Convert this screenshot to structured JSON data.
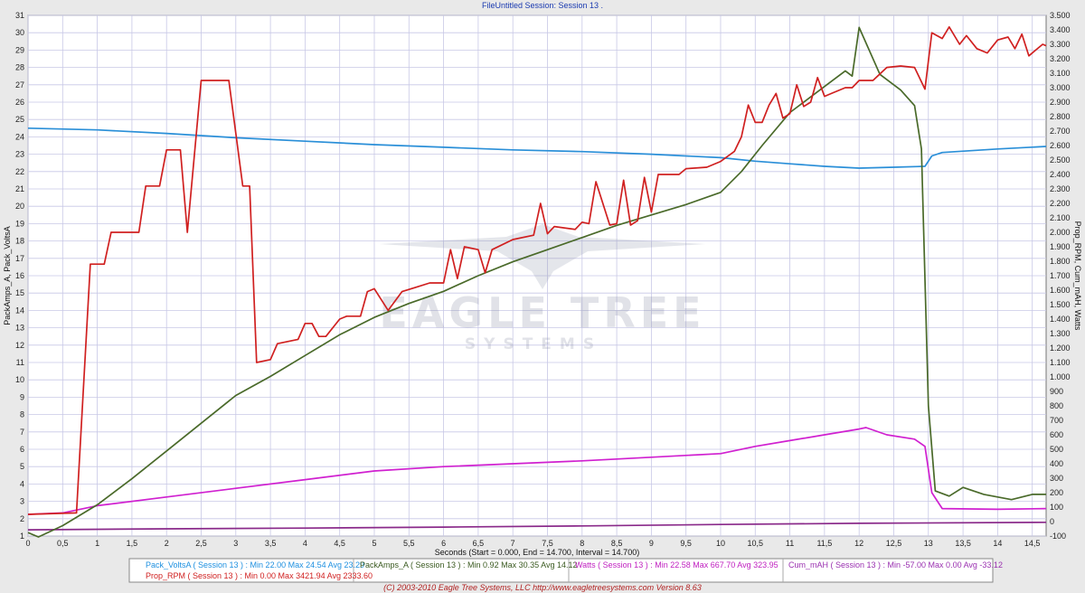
{
  "chart_data": {
    "type": "line",
    "title": "FileUntitled  Session: Session 13 .",
    "xlabel": "Seconds (Start = 0.000,  End = 14.700,  Interval = 14.700)",
    "ylabel_left": "PackAmps_A, Pack_VoltsA",
    "ylabel_right": "Prop_RPM, Cum_mAH, Watts",
    "xlim": [
      0,
      14.7
    ],
    "ylim_left": [
      1,
      31
    ],
    "ylim_right": [
      -100,
      3500
    ],
    "grid": true,
    "x_ticks": [
      "0",
      "0,5",
      "1",
      "1,5",
      "2",
      "2,5",
      "3",
      "3,5",
      "4",
      "4,5",
      "5",
      "5,5",
      "6",
      "6,5",
      "7",
      "7,5",
      "8",
      "8,5",
      "9",
      "9,5",
      "10",
      "10,5",
      "11",
      "11,5",
      "12",
      "12,5",
      "13",
      "13,5",
      "14",
      "14,5"
    ],
    "y_left_ticks": [
      "1",
      "2",
      "3",
      "4",
      "5",
      "6",
      "7",
      "8",
      "9",
      "10",
      "11",
      "12",
      "13",
      "14",
      "15",
      "16",
      "17",
      "18",
      "19",
      "20",
      "21",
      "22",
      "23",
      "24",
      "25",
      "26",
      "27",
      "28",
      "29",
      "30",
      "31"
    ],
    "y_right_ticks": [
      "-100",
      "0",
      "100",
      "200",
      "300",
      "400",
      "500",
      "600",
      "700",
      "800",
      "900",
      "1.000",
      "1.100",
      "1.200",
      "1.300",
      "1.400",
      "1.500",
      "1.600",
      "1.700",
      "1.800",
      "1.900",
      "2.000",
      "2.100",
      "2.200",
      "2.300",
      "2.400",
      "2.500",
      "2.600",
      "2.700",
      "2.800",
      "2.900",
      "3.000",
      "3.100",
      "3.200",
      "3.300",
      "3.400",
      "3.500"
    ],
    "series": [
      {
        "name": "Pack_VoltsA",
        "axis": "left",
        "color": "#2a8fd8",
        "points": [
          [
            0,
            24.5
          ],
          [
            1,
            24.4
          ],
          [
            2,
            24.2
          ],
          [
            3,
            23.95
          ],
          [
            4,
            23.75
          ],
          [
            5,
            23.55
          ],
          [
            6,
            23.4
          ],
          [
            7,
            23.25
          ],
          [
            8,
            23.15
          ],
          [
            9,
            23
          ],
          [
            10,
            22.8
          ],
          [
            10.5,
            22.6
          ],
          [
            11,
            22.45
          ],
          [
            11.5,
            22.3
          ],
          [
            12,
            22.2
          ],
          [
            12.5,
            22.25
          ],
          [
            12.95,
            22.3
          ],
          [
            13.05,
            22.9
          ],
          [
            13.2,
            23.1
          ],
          [
            14,
            23.3
          ],
          [
            14.7,
            23.45
          ]
        ]
      },
      {
        "name": "PackAmps_A",
        "axis": "left",
        "color": "#4a6a2a",
        "points": [
          [
            0,
            1.2
          ],
          [
            0.15,
            0.95
          ],
          [
            0.5,
            1.6
          ],
          [
            1,
            2.8
          ],
          [
            1.5,
            4.3
          ],
          [
            2,
            5.9
          ],
          [
            2.5,
            7.5
          ],
          [
            3,
            9.1
          ],
          [
            3.5,
            10.2
          ],
          [
            4,
            11.4
          ],
          [
            4.5,
            12.6
          ],
          [
            5,
            13.6
          ],
          [
            5.5,
            14.4
          ],
          [
            6,
            15.1
          ],
          [
            6.5,
            16
          ],
          [
            7,
            16.8
          ],
          [
            7.5,
            17.5
          ],
          [
            8,
            18.2
          ],
          [
            8.5,
            18.9
          ],
          [
            9,
            19.5
          ],
          [
            9.5,
            20.1
          ],
          [
            10,
            20.8
          ],
          [
            10.3,
            22
          ],
          [
            10.6,
            23.5
          ],
          [
            11,
            25.4
          ],
          [
            11.5,
            26.9
          ],
          [
            11.8,
            27.8
          ],
          [
            11.9,
            27.5
          ],
          [
            12,
            30.3
          ],
          [
            12.3,
            27.6
          ],
          [
            12.6,
            26.7
          ],
          [
            12.8,
            25.8
          ],
          [
            12.9,
            23.3
          ],
          [
            13,
            8.5
          ],
          [
            13.1,
            3.6
          ],
          [
            13.3,
            3.3
          ],
          [
            13.5,
            3.8
          ],
          [
            13.8,
            3.4
          ],
          [
            14.2,
            3.1
          ],
          [
            14.5,
            3.4
          ],
          [
            14.7,
            3.4
          ]
        ]
      },
      {
        "name": "Watts",
        "axis": "right",
        "color": "#d020d0",
        "points": [
          [
            0,
            50
          ],
          [
            0.5,
            60
          ],
          [
            1,
            110
          ],
          [
            2,
            170
          ],
          [
            3,
            230
          ],
          [
            4,
            290
          ],
          [
            5,
            350
          ],
          [
            6,
            380
          ],
          [
            7,
            400
          ],
          [
            8,
            420
          ],
          [
            9,
            445
          ],
          [
            10,
            470
          ],
          [
            10.5,
            520
          ],
          [
            11,
            560
          ],
          [
            11.5,
            600
          ],
          [
            12,
            640
          ],
          [
            12.1,
            650
          ],
          [
            12.4,
            600
          ],
          [
            12.8,
            570
          ],
          [
            12.95,
            520
          ],
          [
            13.05,
            200
          ],
          [
            13.2,
            90
          ],
          [
            14,
            85
          ],
          [
            14.7,
            90
          ]
        ]
      },
      {
        "name": "Prop_RPM",
        "axis": "right",
        "color": "#d02020",
        "points": [
          [
            0,
            50
          ],
          [
            0.7,
            60
          ],
          [
            0.9,
            1780
          ],
          [
            1.1,
            1780
          ],
          [
            1.2,
            2000
          ],
          [
            1.6,
            2000
          ],
          [
            1.7,
            2320
          ],
          [
            1.9,
            2320
          ],
          [
            2,
            2570
          ],
          [
            2.2,
            2570
          ],
          [
            2.3,
            2000
          ],
          [
            2.5,
            3050
          ],
          [
            2.7,
            3050
          ],
          [
            2.9,
            3050
          ],
          [
            3.1,
            2320
          ],
          [
            3.2,
            2320
          ],
          [
            3.3,
            1100
          ],
          [
            3.5,
            1120
          ],
          [
            3.6,
            1230
          ],
          [
            3.9,
            1260
          ],
          [
            4,
            1370
          ],
          [
            4.1,
            1370
          ],
          [
            4.2,
            1280
          ],
          [
            4.3,
            1280
          ],
          [
            4.5,
            1400
          ],
          [
            4.6,
            1420
          ],
          [
            4.8,
            1420
          ],
          [
            4.9,
            1590
          ],
          [
            5,
            1610
          ],
          [
            5.2,
            1460
          ],
          [
            5.4,
            1590
          ],
          [
            5.6,
            1620
          ],
          [
            5.8,
            1650
          ],
          [
            6,
            1650
          ],
          [
            6.1,
            1880
          ],
          [
            6.2,
            1680
          ],
          [
            6.3,
            1900
          ],
          [
            6.5,
            1880
          ],
          [
            6.6,
            1720
          ],
          [
            6.7,
            1880
          ],
          [
            7,
            1950
          ],
          [
            7.3,
            1980
          ],
          [
            7.4,
            2200
          ],
          [
            7.5,
            1990
          ],
          [
            7.6,
            2040
          ],
          [
            7.9,
            2020
          ],
          [
            8,
            2070
          ],
          [
            8.1,
            2060
          ],
          [
            8.2,
            2350
          ],
          [
            8.4,
            2050
          ],
          [
            8.5,
            2060
          ],
          [
            8.6,
            2360
          ],
          [
            8.7,
            2050
          ],
          [
            8.8,
            2080
          ],
          [
            8.9,
            2380
          ],
          [
            9,
            2140
          ],
          [
            9.1,
            2400
          ],
          [
            9.4,
            2400
          ],
          [
            9.5,
            2440
          ],
          [
            9.8,
            2450
          ],
          [
            10,
            2490
          ],
          [
            10.2,
            2560
          ],
          [
            10.3,
            2660
          ],
          [
            10.4,
            2880
          ],
          [
            10.5,
            2760
          ],
          [
            10.6,
            2760
          ],
          [
            10.7,
            2880
          ],
          [
            10.8,
            2960
          ],
          [
            10.9,
            2790
          ],
          [
            11,
            2820
          ],
          [
            11.1,
            3020
          ],
          [
            11.2,
            2870
          ],
          [
            11.3,
            2900
          ],
          [
            11.4,
            3070
          ],
          [
            11.5,
            2940
          ],
          [
            11.6,
            2960
          ],
          [
            11.8,
            3000
          ],
          [
            11.9,
            3000
          ],
          [
            12,
            3050
          ],
          [
            12.2,
            3050
          ],
          [
            12.4,
            3140
          ],
          [
            12.6,
            3150
          ],
          [
            12.8,
            3140
          ],
          [
            12.95,
            2990
          ],
          [
            13.05,
            3380
          ],
          [
            13.2,
            3340
          ],
          [
            13.3,
            3420
          ],
          [
            13.45,
            3300
          ],
          [
            13.55,
            3360
          ],
          [
            13.7,
            3270
          ],
          [
            13.85,
            3240
          ],
          [
            14,
            3330
          ],
          [
            14.15,
            3350
          ],
          [
            14.25,
            3270
          ],
          [
            14.35,
            3370
          ],
          [
            14.45,
            3220
          ],
          [
            14.55,
            3260
          ],
          [
            14.65,
            3300
          ],
          [
            14.7,
            3290
          ]
        ]
      },
      {
        "name": "Cum_mAH",
        "axis": "right",
        "color": "#8a2a8a",
        "points": [
          [
            0,
            -57
          ],
          [
            2,
            -50
          ],
          [
            4,
            -45
          ],
          [
            6,
            -38
          ],
          [
            8,
            -30
          ],
          [
            10,
            -20
          ],
          [
            12,
            -12
          ],
          [
            14.7,
            -5
          ]
        ]
      }
    ]
  },
  "watermark": {
    "brand": "EAGLE TREE",
    "sub": "SYSTEMS"
  },
  "legend": [
    {
      "text": "Pack_VoltsA ( Session 13 ) : Min 22.00   Max 24.54   Avg 23.29",
      "color": "#1e90e0"
    },
    {
      "text": "Prop_RPM ( Session 13 ) : Min 0.00   Max 3421.94   Avg 2333.60",
      "color": "#d02020"
    },
    {
      "text": "PackAmps_A ( Session 13 ) : Min 0.92   Max 30.35   Avg 14.12",
      "color": "#3a5a20"
    },
    {
      "text": "Watts ( Session 13 ) : Min 22.58   Max 667.70   Avg 323.95",
      "color": "#c020c0"
    },
    {
      "text": "Cum_mAH ( Session 13 ) : Min -57.00   Max 0.00   Avg -33.12",
      "color": "#9a30b0"
    }
  ],
  "footer": "(C) 2003-2010 Eagle Tree Systems, LLC     http://www.eagletreesystems.com     Version 8.63"
}
